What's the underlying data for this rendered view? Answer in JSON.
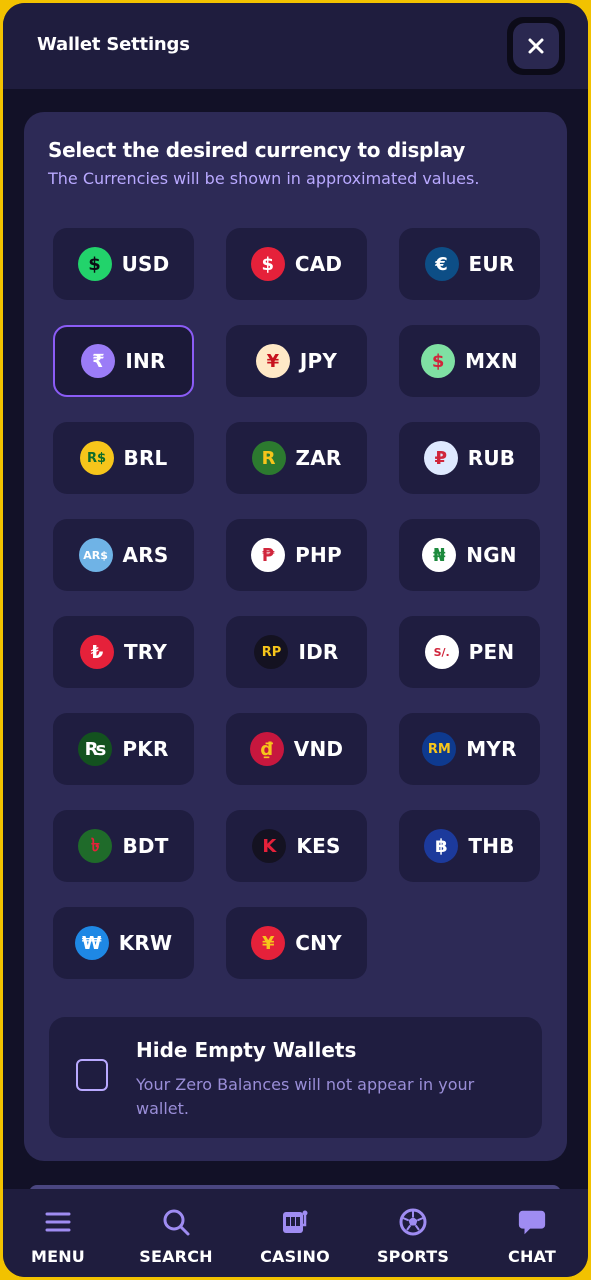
{
  "header": {
    "title": "Wallet Settings",
    "close_icon": "close-icon"
  },
  "panel": {
    "title": "Select the desired currency to display",
    "subtitle": "The Currencies will be shown in approximated values."
  },
  "currencies": [
    {
      "code": "USD",
      "symbol": "$",
      "icon_bg": "#22d36b",
      "icon_fg": "#0b0b14",
      "selected": false
    },
    {
      "code": "CAD",
      "symbol": "$",
      "icon_bg": "#e5213a",
      "icon_fg": "#ffffff",
      "selected": false
    },
    {
      "code": "EUR",
      "symbol": "€",
      "icon_bg": "#0d4e86",
      "icon_fg": "#ffffff",
      "selected": false
    },
    {
      "code": "INR",
      "symbol": "₹",
      "icon_bg": "#9b7cf7",
      "icon_fg": "#ffffff",
      "selected": true
    },
    {
      "code": "JPY",
      "symbol": "¥",
      "icon_bg": "#ffe9c7",
      "icon_fg": "#c7121d",
      "selected": false
    },
    {
      "code": "MXN",
      "symbol": "$",
      "icon_bg": "#7fe0a3",
      "icon_fg": "#d0253b",
      "selected": false
    },
    {
      "code": "BRL",
      "symbol": "R$",
      "icon_bg": "#f6c51b",
      "icon_fg": "#0d6b2b",
      "selected": false
    },
    {
      "code": "ZAR",
      "symbol": "R",
      "icon_bg": "#2c7a2f",
      "icon_fg": "#f6c51b",
      "selected": false
    },
    {
      "code": "RUB",
      "symbol": "₽",
      "icon_bg": "#dfe9ff",
      "icon_fg": "#d0253b",
      "selected": false
    },
    {
      "code": "ARS",
      "symbol": "AR$",
      "icon_bg": "#6fb3e6",
      "icon_fg": "#ffffff",
      "selected": false
    },
    {
      "code": "PHP",
      "symbol": "₱",
      "icon_bg": "#ffffff",
      "icon_fg": "#d0253b",
      "selected": false
    },
    {
      "code": "NGN",
      "symbol": "₦",
      "icon_bg": "#ffffff",
      "icon_fg": "#1d8a3d",
      "selected": false
    },
    {
      "code": "TRY",
      "symbol": "₺",
      "icon_bg": "#e5213a",
      "icon_fg": "#ffffff",
      "selected": false
    },
    {
      "code": "IDR",
      "symbol": "RP",
      "icon_bg": "#141221",
      "icon_fg": "#f6c51b",
      "selected": false
    },
    {
      "code": "PEN",
      "symbol": "S/.",
      "icon_bg": "#ffffff",
      "icon_fg": "#d0253b",
      "selected": false
    },
    {
      "code": "PKR",
      "symbol": "₨",
      "icon_bg": "#13521f",
      "icon_fg": "#ffffff",
      "selected": false
    },
    {
      "code": "VND",
      "symbol": "₫",
      "icon_bg": "#c7173e",
      "icon_fg": "#f6c51b",
      "selected": false
    },
    {
      "code": "MYR",
      "symbol": "RM",
      "icon_bg": "#0e3a8f",
      "icon_fg": "#f6c51b",
      "selected": false
    },
    {
      "code": "BDT",
      "symbol": "৳",
      "icon_bg": "#1f6b2a",
      "icon_fg": "#e5213a",
      "selected": false
    },
    {
      "code": "KES",
      "symbol": "K",
      "icon_bg": "#141221",
      "icon_fg": "#e5213a",
      "selected": false
    },
    {
      "code": "THB",
      "symbol": "฿",
      "icon_bg": "#1c3a9c",
      "icon_fg": "#ffffff",
      "selected": false
    },
    {
      "code": "KRW",
      "symbol": "₩",
      "icon_bg": "#1e88e5",
      "icon_fg": "#ffffff",
      "selected": false
    },
    {
      "code": "CNY",
      "symbol": "¥",
      "icon_bg": "#e5213a",
      "icon_fg": "#f6c51b",
      "selected": false
    }
  ],
  "hide_empty": {
    "title": "Hide Empty Wallets",
    "description": "Your Zero Balances will not appear in your wallet.",
    "checked": false
  },
  "nav": [
    {
      "label": "MENU",
      "icon": "menu-icon"
    },
    {
      "label": "SEARCH",
      "icon": "search-icon"
    },
    {
      "label": "CASINO",
      "icon": "slot-machine-icon"
    },
    {
      "label": "SPORTS",
      "icon": "soccer-ball-icon"
    },
    {
      "label": "CHAT",
      "icon": "chat-bubble-icon"
    }
  ],
  "colors": {
    "frame": "#f2c200",
    "accent": "#8b5cf6",
    "panel": "#2d2a56",
    "chip": "#1f1d40",
    "nav_icon": "#9f8cf2"
  }
}
